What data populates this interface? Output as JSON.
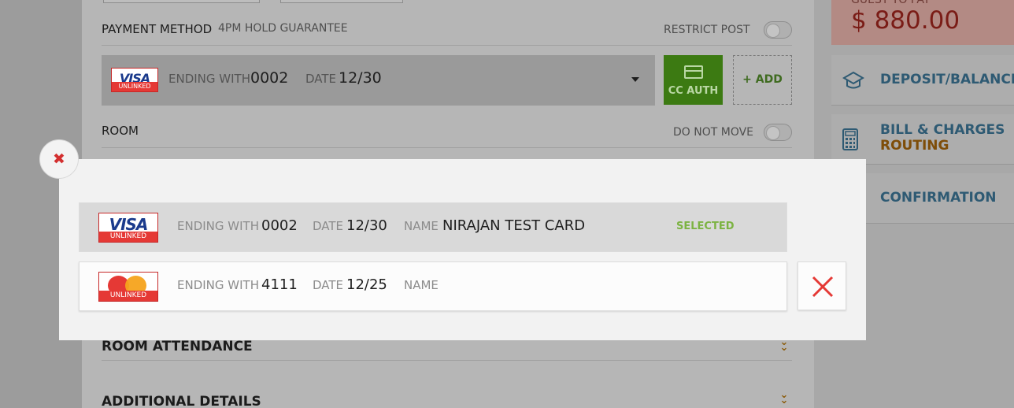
{
  "background": {
    "payment_method_label": "PAYMENT METHOD",
    "hold_label": "4PM HOLD GUARANTEE",
    "restrict_post_label": "RESTRICT POST",
    "card": {
      "brand": "VISA",
      "status": "UNLINKED",
      "ending_label": "ENDING WITH",
      "ending_value": "0002",
      "date_label": "DATE",
      "date_value": "12/30"
    },
    "cc_auth_label": "CC AUTH",
    "add_label": "+ ADD",
    "room_label": "ROOM",
    "do_not_move_label": "DO NOT MOVE",
    "room_attendance_label": "ROOM ATTENDANCE",
    "additional_details_label": "ADDITIONAL DETAILS"
  },
  "sidebar": {
    "guest_to_pay_label": "GUEST TO PAY",
    "amount": "$ 880.00",
    "items": [
      {
        "label": "DEPOSIT/BALANCE",
        "icon": "deposit-icon"
      },
      {
        "label": "BILL & CHARGES",
        "sublabel": "ROUTING",
        "icon": "calculator-icon"
      },
      {
        "label": "CONFIRMATION"
      }
    ]
  },
  "modal": {
    "close_icon": "close-icon",
    "cards": [
      {
        "brand": "VISA",
        "status": "UNLINKED",
        "ending_label": "ENDING WITH",
        "ending_value": "0002",
        "date_label": "DATE",
        "date_value": "12/30",
        "name_label": "NAME",
        "name_value": "NIRAJAN TEST CARD",
        "selected_label": "SELECTED"
      },
      {
        "brand": "mastercard",
        "status": "UNLINKED",
        "ending_label": "ENDING WITH",
        "ending_value": "4111",
        "date_label": "DATE",
        "date_value": "12/25",
        "name_label": "NAME",
        "name_value": ""
      }
    ],
    "delete_icon": "delete-icon"
  },
  "colors": {
    "accent_green": "#7cb342",
    "cc_auth_green": "#3c7a12",
    "danger_red": "#e53935",
    "side_blue": "#2e5a73",
    "side_orange": "#7e4d08"
  }
}
